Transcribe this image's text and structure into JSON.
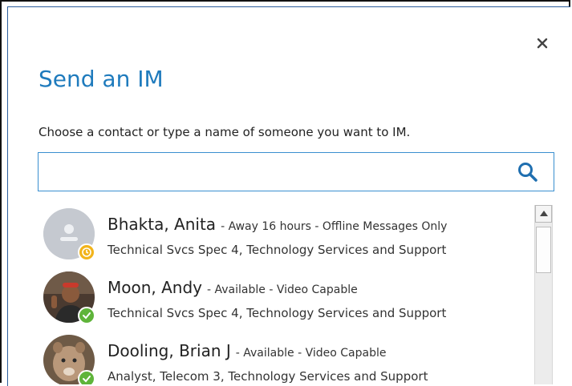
{
  "dialog": {
    "title": "Send an IM",
    "instruction": "Choose a contact or type a name of someone you want to IM.",
    "search": {
      "value": "",
      "placeholder": ""
    }
  },
  "contacts": [
    {
      "name": "Bhakta, Anita",
      "presence": "- Away 16 hours - Offline Messages Only",
      "role": "Technical Svcs Spec 4, Technology Services and Support",
      "status": "away",
      "avatar": "default-person-icon"
    },
    {
      "name": "Moon, Andy",
      "presence": "- Available - Video Capable",
      "role": "Technical Svcs Spec 4, Technology Services and Support",
      "status": "available",
      "avatar": "photo"
    },
    {
      "name": "Dooling, Brian J",
      "presence": "- Available - Video Capable",
      "role": "Analyst, Telecom 3, Technology Services and Support",
      "status": "available",
      "avatar": "photo"
    }
  ],
  "colors": {
    "accent": "#1f7bbd",
    "away": "#f2b41b",
    "available": "#5fb43a",
    "search_border": "#3a8fd0"
  }
}
